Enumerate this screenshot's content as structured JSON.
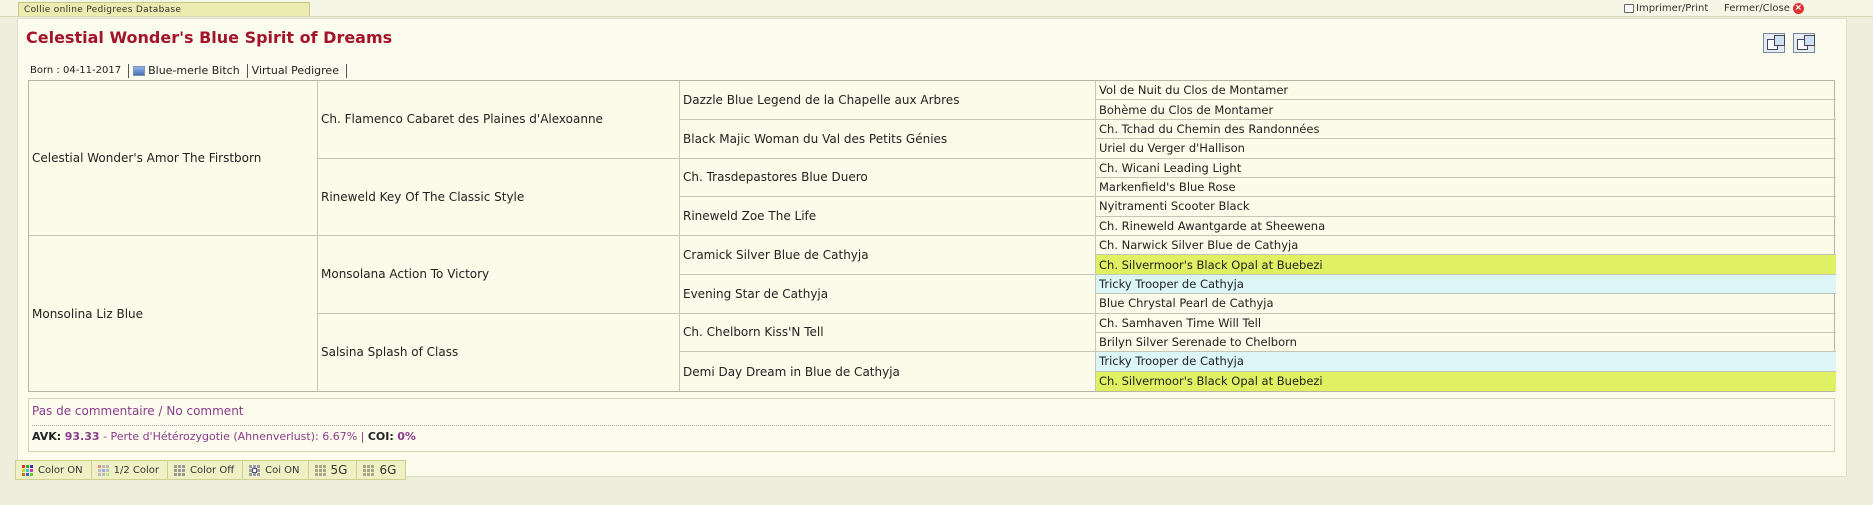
{
  "topbar": {
    "db_title": "Collie online Pedigrees Database",
    "print_label": "Imprimer/Print",
    "close_label": "Fermer/Close"
  },
  "dog": {
    "name": "Celestial Wonder's Blue Spirit of Dreams",
    "born": "Born : 04-11-2017",
    "color_sex": "Blue-merle Bitch",
    "virtual_pedigree": "Virtual Pedigree"
  },
  "pedigree": {
    "gen1": [
      "Celestial Wonder's Amor The Firstborn",
      "Monsolina Liz Blue"
    ],
    "gen2": [
      "Ch. Flamenco Cabaret des Plaines d'Alexoanne",
      "Rineweld Key Of The Classic Style",
      "Monsolana Action To Victory",
      "Salsina Splash of Class"
    ],
    "gen3": [
      "Dazzle Blue Legend de la Chapelle aux Arbres",
      "Black Majic Woman du Val des Petits Génies",
      "Ch. Trasdepastores Blue Duero",
      "Rineweld Zoe The Life",
      "Cramick Silver Blue de Cathyja",
      "Evening Star de Cathyja",
      "Ch. Chelborn Kiss'N Tell",
      "Demi Day Dream in Blue de Cathyja"
    ],
    "gen4": [
      "Vol de Nuit du Clos de Montamer",
      "Bohème du Clos de Montamer",
      "Ch. Tchad du Chemin des Randonnées",
      "Uriel du Verger d'Hallison",
      "Ch. Wicani Leading Light",
      "Markenfield's Blue Rose",
      "Nyitramenti Scooter Black",
      "Ch. Rineweld Awantgarde at Sheewena",
      "Ch. Narwick Silver Blue de Cathyja",
      "Ch. Silvermoor's Black Opal at Buebezi",
      "Tricky Trooper de Cathyja",
      "Blue Chrystal Pearl de Cathyja",
      "Ch. Samhaven Time Will Tell",
      "Brilyn Silver Serenade to Chelborn",
      "Tricky Trooper de Cathyja",
      "Ch. Silvermoor's Black Opal at Buebezi"
    ],
    "highlight_colors": {
      "yellow": "#dff062",
      "blue": "#dcf6f8"
    }
  },
  "comment": {
    "no_comment": "Pas de commentaire / No comment",
    "avk_label": "AVK:",
    "avk_value": "93.33",
    "avk_desc": "- Perte d'Hétérozygotie (Ahnenverlust): 6.67% |",
    "coi_label": "COI:",
    "coi_value": "0%"
  },
  "buttons": {
    "color_on": "Color ON",
    "half_color": "1/2 Color",
    "color_off": "Color Off",
    "coi_on": "Coi ON",
    "gen5": "5G",
    "gen6": "6G"
  },
  "colors": {
    "title": "#a3132a",
    "comment_text": "#8a3d8a"
  }
}
